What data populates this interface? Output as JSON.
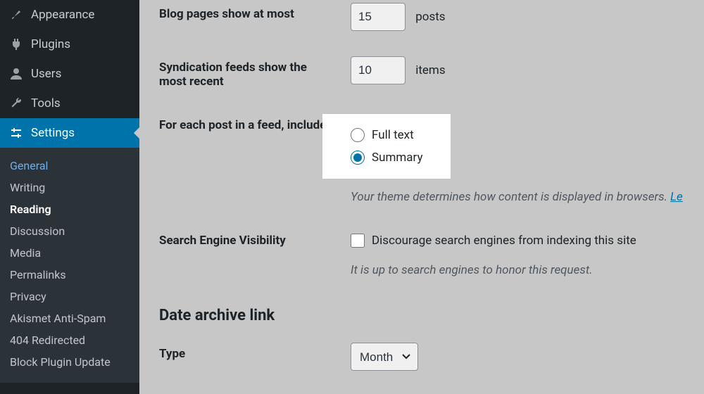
{
  "sidebar": {
    "primary": [
      {
        "label": "Appearance",
        "icon": "brush"
      },
      {
        "label": "Plugins",
        "icon": "plug"
      },
      {
        "label": "Users",
        "icon": "user"
      },
      {
        "label": "Tools",
        "icon": "wrench"
      },
      {
        "label": "Settings",
        "icon": "sliders",
        "current": true
      }
    ],
    "settings_submenu": [
      {
        "label": "General",
        "state": "active-link"
      },
      {
        "label": "Writing"
      },
      {
        "label": "Reading",
        "state": "current-sub"
      },
      {
        "label": "Discussion"
      },
      {
        "label": "Media"
      },
      {
        "label": "Permalinks"
      },
      {
        "label": "Privacy"
      },
      {
        "label": "Akismet Anti-Spam"
      },
      {
        "label": "404 Redirected"
      },
      {
        "label": "Block Plugin Update"
      }
    ]
  },
  "settings": {
    "blog_pages": {
      "label": "Blog pages show at most",
      "value": "15",
      "suffix": "posts"
    },
    "syndication": {
      "label": "Syndication feeds show the most recent",
      "value": "10",
      "suffix": "items"
    },
    "feed_include": {
      "label": "For each post in a feed, include",
      "full_text": "Full text",
      "summary": "Summary",
      "selected": "summary",
      "description_prefix": "Your theme determines how content is displayed in browsers. ",
      "description_link": "Le"
    },
    "search_visibility": {
      "label": "Search Engine Visibility",
      "checkbox_label": "Discourage search engines from indexing this site",
      "checked": false,
      "description": "It is up to search engines to honor this request."
    },
    "date_archive": {
      "heading": "Date archive link",
      "type_label": "Type",
      "type_value": "Month"
    }
  }
}
